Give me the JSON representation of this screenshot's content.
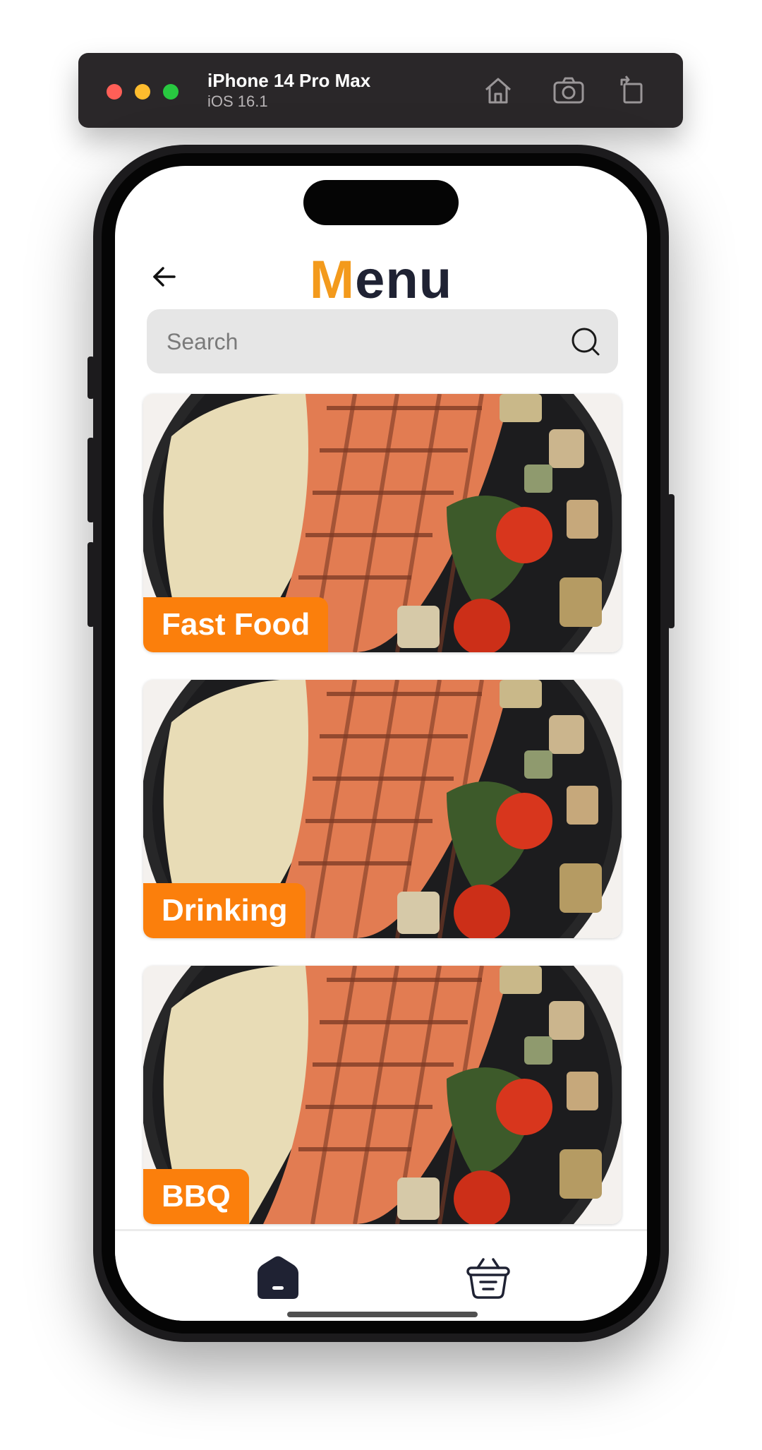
{
  "simulator": {
    "device_name": "iPhone 14 Pro Max",
    "os_version": "iOS 16.1",
    "icons": [
      "home-icon",
      "screenshot-icon",
      "rotate-icon"
    ]
  },
  "header": {
    "title_first_letter": "M",
    "title_rest": "enu",
    "accent_color": "#f39a1c",
    "back_icon": "arrow-left-icon"
  },
  "search": {
    "placeholder": "Search",
    "value": "",
    "icon": "search-icon"
  },
  "categories": [
    {
      "label": "Fast Food"
    },
    {
      "label": "Drinking"
    },
    {
      "label": "BBQ"
    }
  ],
  "tabbar": {
    "items": [
      {
        "icon": "home-icon",
        "active": true
      },
      {
        "icon": "basket-icon",
        "active": false
      }
    ]
  },
  "colors": {
    "label_background": "#fb7f0c",
    "title_dark": "#1f2233"
  }
}
